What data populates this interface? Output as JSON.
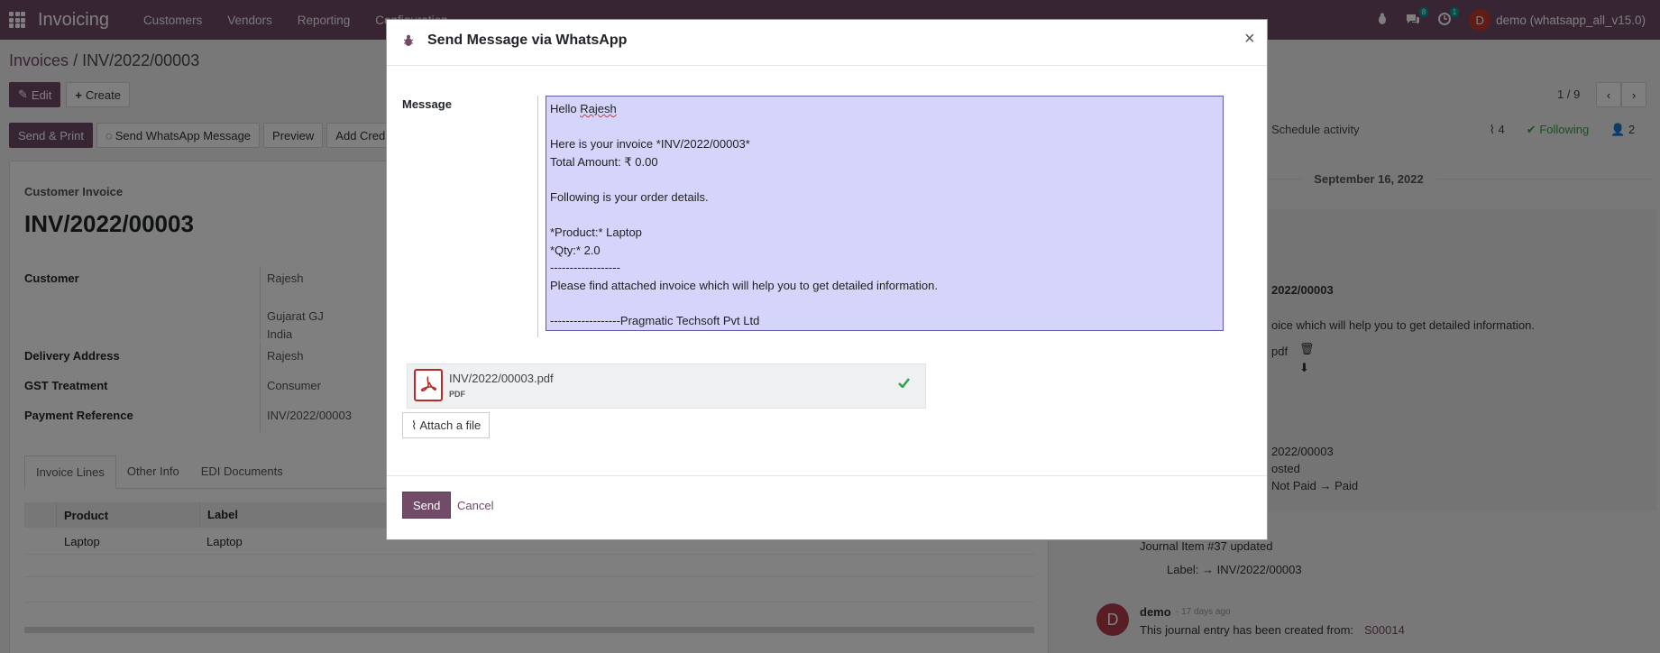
{
  "navbar": {
    "app_name": "Invoicing",
    "menu": [
      "Customers",
      "Vendors",
      "Reporting",
      "Configuration"
    ],
    "messages_count": "8",
    "activities_count": "1",
    "user_initial": "D",
    "user_name": "demo (whatsapp_all_v15.0)"
  },
  "breadcrumb": {
    "parent": "Invoices",
    "separator": "/",
    "current": "INV/2022/00003"
  },
  "control": {
    "edit_label": "Edit",
    "create_label": "Create",
    "pager_value": "1 / 9"
  },
  "status_bar": {
    "send_print": "Send & Print",
    "send_whatsapp": "Send WhatsApp Message",
    "preview": "Preview",
    "add_credit": "Add Credit Note"
  },
  "sheet": {
    "doc_type": "Customer Invoice",
    "name": "INV/2022/00003",
    "fields": [
      {
        "label": "Customer",
        "value": "Rajesh"
      },
      {
        "label": "",
        "value": "Gujarat GJ"
      },
      {
        "label": "",
        "value": "India"
      },
      {
        "label": "Delivery Address",
        "value": "Rajesh"
      },
      {
        "label": "GST Treatment",
        "value": "Consumer"
      },
      {
        "label": "Payment Reference",
        "value": "INV/2022/00003"
      }
    ],
    "tabs": [
      "Invoice Lines",
      "Other Info",
      "EDI Documents"
    ],
    "lines_headers": [
      "Product",
      "Label"
    ],
    "line": {
      "product": "Laptop",
      "label": "Laptop"
    }
  },
  "chatter": {
    "schedule": "Schedule activity",
    "attachments_count": "4",
    "following": "Following",
    "followers_count": "2",
    "date": "September 16, 2022",
    "snippets": [
      "2022/00003",
      "oice which will help you to get detailed information.",
      "pdf",
      "2022/00003",
      "osted",
      "Not Paid → Paid",
      "Journal Item #37 updated",
      "Label: → INV/2022/00003"
    ],
    "last_author": "demo",
    "last_time": "- 17 days ago",
    "last_text": "This journal entry has been created from:",
    "last_link": "S00014",
    "avatar_initial": "D"
  },
  "modal": {
    "title": "Send Message via WhatsApp",
    "close": "×",
    "message_label": "Message",
    "message_lines": [
      "Hello Rajesh",
      "",
      "Here is your invoice *INV/2022/00003*",
      "Total Amount: ₹ 0.00",
      "",
      "Following is your order details.",
      "",
      "*Product:* Laptop",
      "*Qty:* 2.0",
      "------------------",
      "Please find attached invoice which will help you to get detailed information.",
      "",
      "------------------Pragmatic Techsoft Pvt Ltd"
    ],
    "attachment_name": "INV/2022/00003.pdf",
    "attachment_type": "PDF",
    "attach_file": "Attach a file",
    "send": "Send",
    "cancel": "Cancel"
  },
  "colors": {
    "brand": "#714B67",
    "message_bg": "#d5d4fb",
    "pdf_red": "#b52b27",
    "success": "#28a745"
  }
}
